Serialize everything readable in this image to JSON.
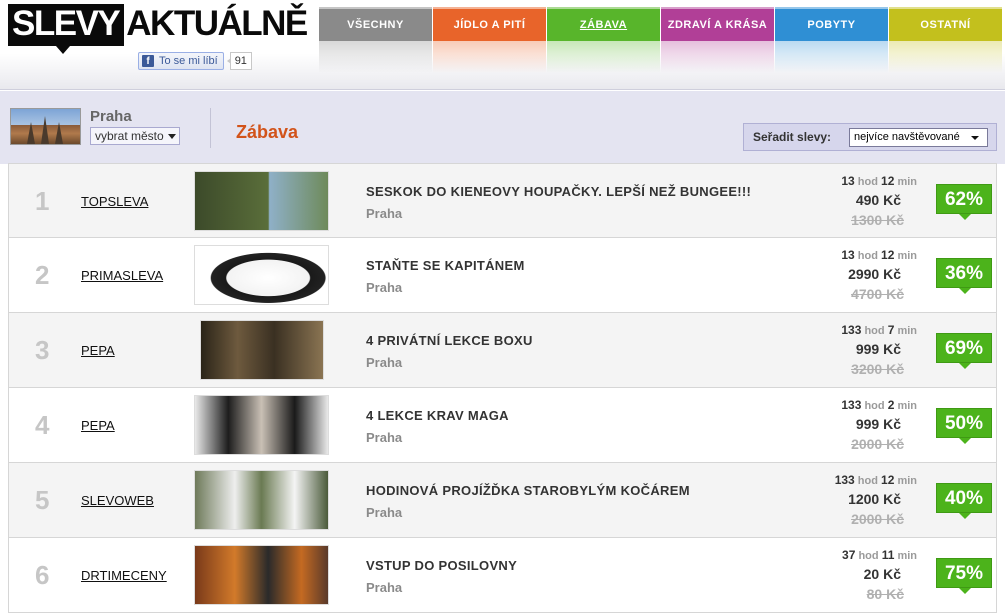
{
  "header": {
    "logo_part1": "SLEVY",
    "logo_part2": "AKTUÁLNĚ",
    "fb_like_label": "To se mi líbí",
    "fb_like_count": "91"
  },
  "nav": {
    "tabs": [
      {
        "label": "VŠECHNY",
        "color": "#8a8a8a",
        "active": false
      },
      {
        "label": "JÍDLO A PITÍ",
        "color": "#e8642a",
        "active": false
      },
      {
        "label": "ZÁBAVA",
        "color": "#58b52b",
        "active": true
      },
      {
        "label": "ZDRAVÍ A KRÁSA",
        "color": "#b13f97",
        "active": false
      },
      {
        "label": "POBYTY",
        "color": "#2f8fd4",
        "active": false
      },
      {
        "label": "OSTATNÍ",
        "color": "#c3c01d",
        "active": false
      }
    ]
  },
  "filter": {
    "city_name": "Praha",
    "city_select_label": "vybrat město",
    "category_title": "Zábava",
    "sort_label": "Seřadit slevy:",
    "sort_value": "nejvíce navštěvované"
  },
  "deals": [
    {
      "rank": "1",
      "vendor": "TOPSLEVA",
      "title": "SESKOK DO KIENEOVY HOUPAČKY. LEPŠÍ NEŽ BUNGEE!!!",
      "city": "Praha",
      "time_h": "13",
      "time_m": "12",
      "price": "490 Kč",
      "old_price": "1300 Kč",
      "discount": "62%"
    },
    {
      "rank": "2",
      "vendor": "PRIMASLEVA",
      "title": "STAŇTE SE KAPITÁNEM",
      "city": "Praha",
      "time_h": "13",
      "time_m": "12",
      "price": "2990 Kč",
      "old_price": "4700 Kč",
      "discount": "36%"
    },
    {
      "rank": "3",
      "vendor": "PEPA",
      "title": "4 PRIVÁTNÍ LEKCE BOXU",
      "city": "Praha",
      "time_h": "133",
      "time_m": "7",
      "price": "999 Kč",
      "old_price": "3200 Kč",
      "discount": "69%"
    },
    {
      "rank": "4",
      "vendor": "PEPA",
      "title": "4 LEKCE KRAV MAGA",
      "city": "Praha",
      "time_h": "133",
      "time_m": "2",
      "price": "999 Kč",
      "old_price": "2000 Kč",
      "discount": "50%"
    },
    {
      "rank": "5",
      "vendor": "SLEVOWEB",
      "title": "HODINOVÁ PROJÍŽĎKA STAROBYLÝM KOČÁREM",
      "city": "Praha",
      "time_h": "133",
      "time_m": "12",
      "price": "1200 Kč",
      "old_price": "2000 Kč",
      "discount": "40%"
    },
    {
      "rank": "6",
      "vendor": "DRTIMECENY",
      "title": "VSTUP DO POSILOVNY",
      "city": "Praha",
      "time_h": "37",
      "time_m": "11",
      "price": "20 Kč",
      "old_price": "80 Kč",
      "discount": "75%"
    }
  ],
  "labels": {
    "hod": "hod",
    "min": "min"
  }
}
